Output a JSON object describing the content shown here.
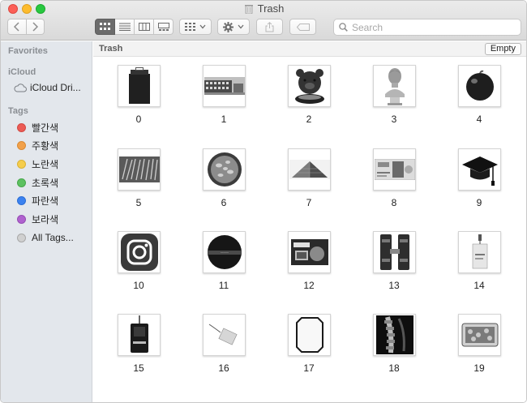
{
  "window": {
    "title": "Trash"
  },
  "toolbar": {
    "search_placeholder": "Search"
  },
  "sidebar": {
    "favorites_heading": "Favorites",
    "icloud_heading": "iCloud",
    "icloud_drive_label": "iCloud Dri...",
    "tags_heading": "Tags",
    "tags": [
      {
        "label": "빨간색",
        "color": "#ec5b55"
      },
      {
        "label": "주황색",
        "color": "#f2a14a"
      },
      {
        "label": "노란색",
        "color": "#f5cd4c"
      },
      {
        "label": "초록색",
        "color": "#5dc160"
      },
      {
        "label": "파란색",
        "color": "#3b82f0"
      },
      {
        "label": "보라색",
        "color": "#b062cf"
      },
      {
        "label": "All Tags...",
        "color": "#c8c8c8"
      }
    ]
  },
  "main": {
    "path_title": "Trash",
    "empty_label": "Empty",
    "items": [
      {
        "label": "0",
        "icon": "trash-bin-photo-icon"
      },
      {
        "label": "1",
        "icon": "building-photo-icon"
      },
      {
        "label": "2",
        "icon": "bear-figure-photo-icon"
      },
      {
        "label": "3",
        "icon": "bust-statue-photo-icon"
      },
      {
        "label": "4",
        "icon": "apple-photo-icon"
      },
      {
        "label": "5",
        "icon": "sticks-photo-icon"
      },
      {
        "label": "6",
        "icon": "bowl-photo-icon"
      },
      {
        "label": "7",
        "icon": "pyramid-photo-icon"
      },
      {
        "label": "8",
        "icon": "banknote-photo-icon"
      },
      {
        "label": "9",
        "icon": "graduation-cap-photo-icon"
      },
      {
        "label": "10",
        "icon": "instagram-logo-photo-icon"
      },
      {
        "label": "11",
        "icon": "compact-case-photo-icon"
      },
      {
        "label": "12",
        "icon": "snack-package-photo-icon"
      },
      {
        "label": "13",
        "icon": "hanging-bags-photo-icon"
      },
      {
        "label": "14",
        "icon": "tag-card-photo-icon"
      },
      {
        "label": "15",
        "icon": "id-badge-photo-icon"
      },
      {
        "label": "16",
        "icon": "price-tag-photo-icon"
      },
      {
        "label": "17",
        "icon": "mirror-photo-icon"
      },
      {
        "label": "18",
        "icon": "xray-spine-photo-icon"
      },
      {
        "label": "19",
        "icon": "food-tray-photo-icon"
      }
    ]
  }
}
